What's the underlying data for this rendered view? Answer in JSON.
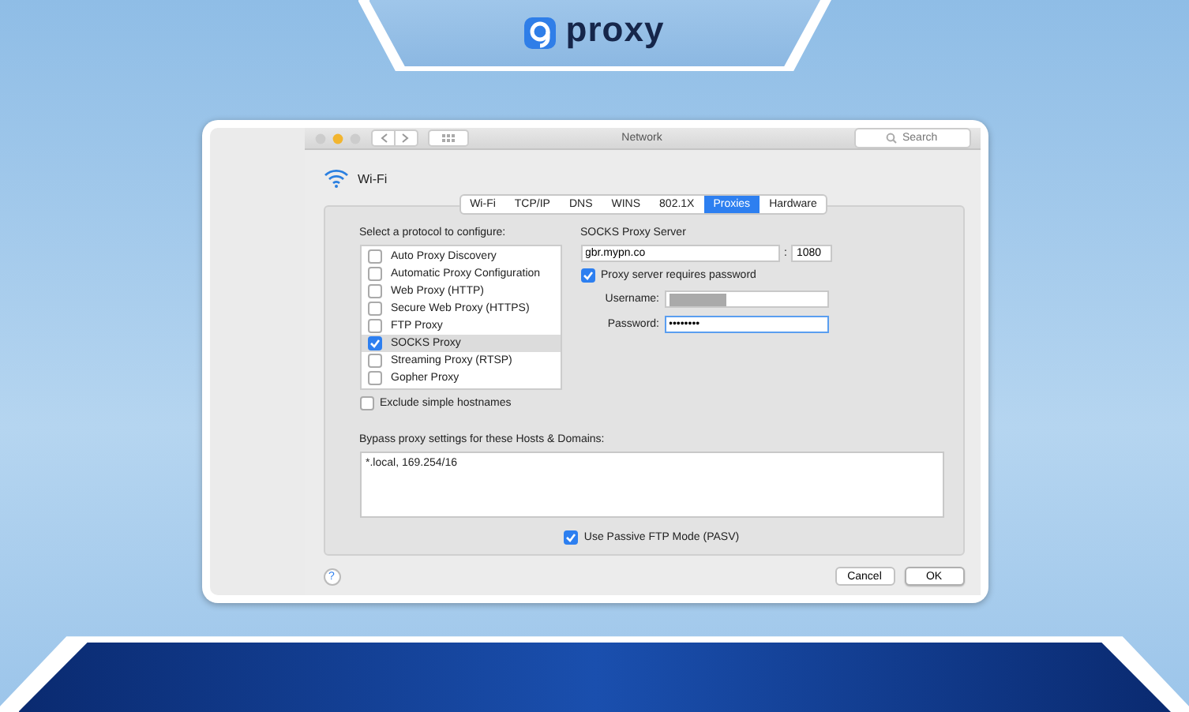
{
  "brand": {
    "name": "proxy"
  },
  "window": {
    "title": "Network",
    "search": {
      "placeholder": "Search"
    }
  },
  "interface": {
    "name": "Wi-Fi"
  },
  "tabs": [
    {
      "label": "Wi-Fi",
      "selected": false
    },
    {
      "label": "TCP/IP",
      "selected": false
    },
    {
      "label": "DNS",
      "selected": false
    },
    {
      "label": "WINS",
      "selected": false
    },
    {
      "label": "802.1X",
      "selected": false
    },
    {
      "label": "Proxies",
      "selected": true
    },
    {
      "label": "Hardware",
      "selected": false
    }
  ],
  "protocols": {
    "label": "Select a protocol to configure:",
    "items": [
      {
        "label": "Auto Proxy Discovery",
        "checked": false,
        "selected": false
      },
      {
        "label": "Automatic Proxy Configuration",
        "checked": false,
        "selected": false
      },
      {
        "label": "Web Proxy (HTTP)",
        "checked": false,
        "selected": false
      },
      {
        "label": "Secure Web Proxy (HTTPS)",
        "checked": false,
        "selected": false
      },
      {
        "label": "FTP Proxy",
        "checked": false,
        "selected": false
      },
      {
        "label": "SOCKS Proxy",
        "checked": true,
        "selected": true
      },
      {
        "label": "Streaming Proxy (RTSP)",
        "checked": false,
        "selected": false
      },
      {
        "label": "Gopher Proxy",
        "checked": false,
        "selected": false
      }
    ]
  },
  "exclude_simple": {
    "label": "Exclude simple hostnames",
    "checked": false
  },
  "server": {
    "heading": "SOCKS Proxy Server",
    "host": "gbr.mypn.co",
    "separator": ":",
    "port": "1080",
    "requires_password": {
      "label": "Proxy server requires password",
      "checked": true
    },
    "username": {
      "label": "Username:"
    },
    "password": {
      "label": "Password:",
      "value": "••••••••"
    }
  },
  "bypass": {
    "label": "Bypass proxy settings for these Hosts & Domains:",
    "value": "*.local, 169.254/16"
  },
  "passive_ftp": {
    "label": "Use Passive FTP Mode (PASV)",
    "checked": true
  },
  "help": "?",
  "buttons": [
    {
      "label": "Cancel",
      "kind": "normal"
    },
    {
      "label": "OK",
      "kind": "default"
    }
  ]
}
